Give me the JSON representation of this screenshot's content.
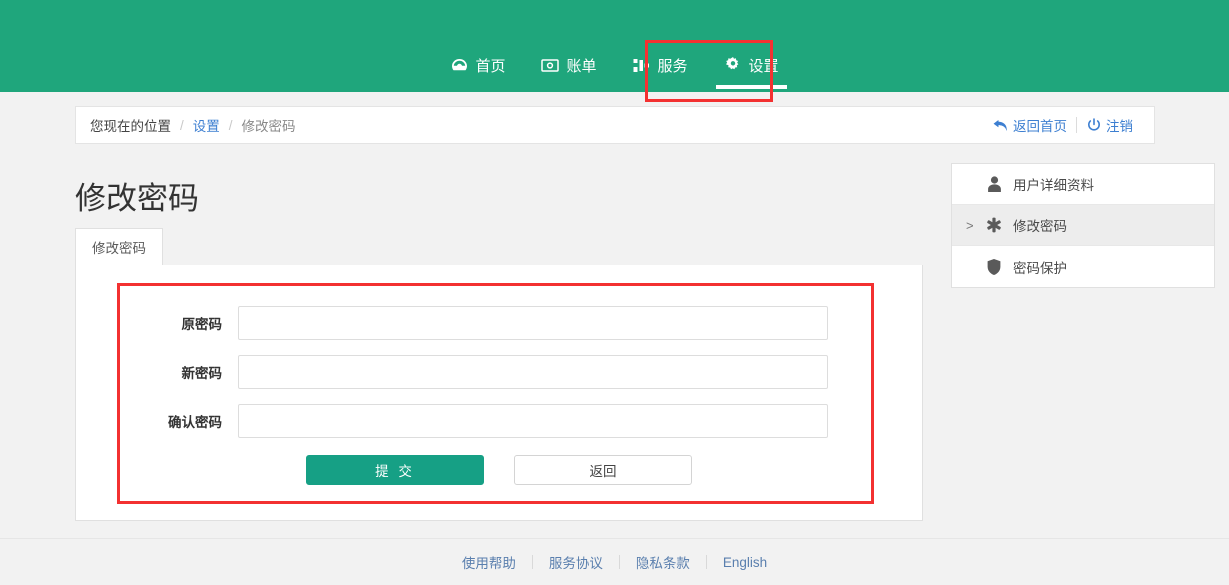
{
  "topnav": {
    "background_color": "#1fa67c",
    "items": [
      {
        "label": "首页",
        "icon": "dashboard-icon",
        "active": false
      },
      {
        "label": "账单",
        "icon": "money-bill-icon",
        "active": false
      },
      {
        "label": "服务",
        "icon": "sitemap-icon",
        "active": false
      },
      {
        "label": "设置",
        "icon": "gear-icon",
        "active": true
      }
    ]
  },
  "breadcrumb": {
    "current_label": "您现在的位置",
    "separator": "/",
    "items": [
      {
        "label": "设置",
        "type": "link"
      },
      {
        "label": "修改密码",
        "type": "current"
      }
    ],
    "actions": [
      {
        "label": "返回首页",
        "icon": "reply-arrow-icon"
      },
      {
        "label": "注销",
        "icon": "power-off-icon"
      }
    ]
  },
  "main": {
    "page_title": "修改密码",
    "tabs": [
      {
        "label": "修改密码",
        "active": true
      }
    ],
    "form": {
      "fields": [
        {
          "label": "原密码",
          "value": "",
          "placeholder": "",
          "name": "old-password"
        },
        {
          "label": "新密码",
          "value": "",
          "placeholder": "",
          "name": "new-password"
        },
        {
          "label": "确认密码",
          "value": "",
          "placeholder": "",
          "name": "confirm-password"
        }
      ],
      "submit_label": "提 交",
      "back_label": "返回"
    }
  },
  "sidebar": {
    "items": [
      {
        "label": "用户详细资料",
        "icon": "user-icon",
        "active": false,
        "caret": ""
      },
      {
        "label": "修改密码",
        "icon": "asterisk-icon",
        "active": true,
        "caret": ">"
      },
      {
        "label": "密码保护",
        "icon": "shield-icon",
        "active": false,
        "caret": ""
      }
    ]
  },
  "footer": {
    "links": [
      {
        "label": "使用帮助"
      },
      {
        "label": "服务协议"
      },
      {
        "label": "隐私条款"
      },
      {
        "label": "English"
      }
    ]
  },
  "annotations": {
    "color": "#f33131",
    "boxes": [
      {
        "name": "nav-settings-highlight"
      },
      {
        "name": "password-form-highlight"
      }
    ]
  }
}
